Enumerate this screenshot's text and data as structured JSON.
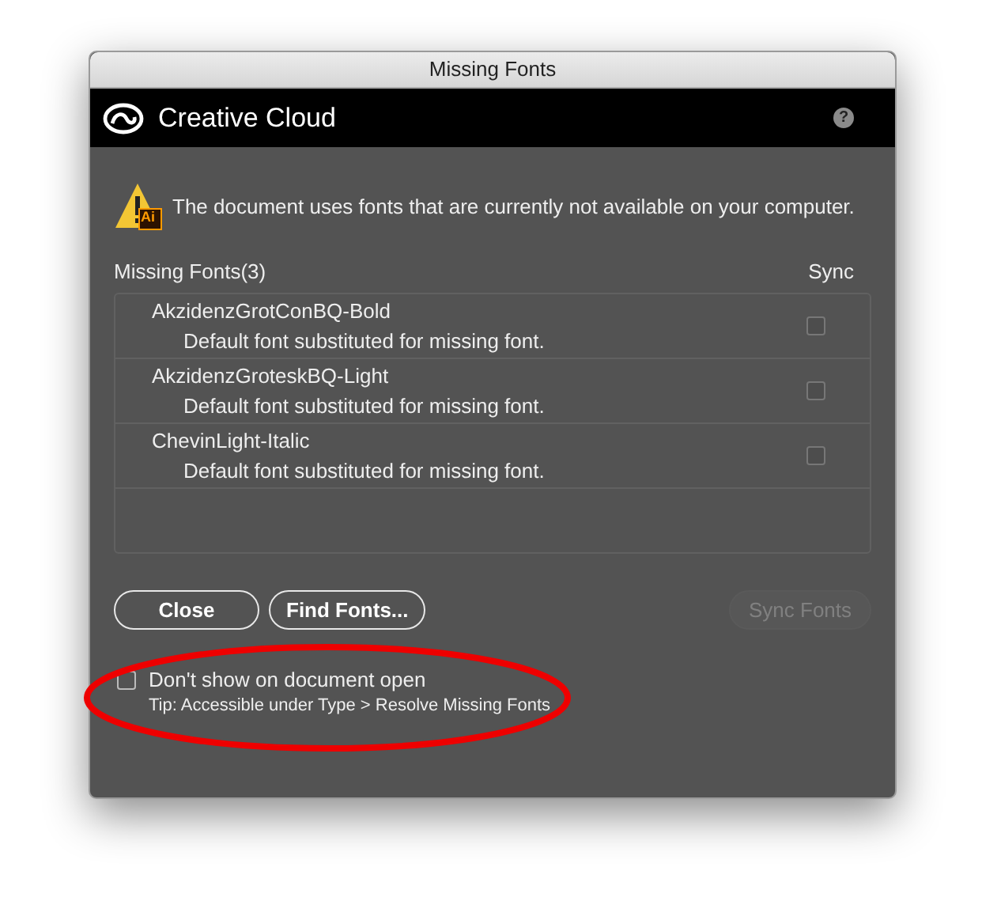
{
  "window": {
    "title": "Missing Fonts"
  },
  "header": {
    "brand": "Creative Cloud",
    "help": "?"
  },
  "message": "The document uses fonts that are currently not available on your computer.",
  "list": {
    "heading": "Missing Fonts(3)",
    "sync_heading": "Sync",
    "rows": [
      {
        "font": "AkzidenzGrotConBQ-Bold",
        "note": "Default font substituted for missing font.",
        "checked": false
      },
      {
        "font": "AkzidenzGroteskBQ-Light",
        "note": "Default font substituted for missing font.",
        "checked": false
      },
      {
        "font": "ChevinLight-Italic",
        "note": "Default font substituted for missing font.",
        "checked": false
      }
    ]
  },
  "buttons": [
    {
      "label": "Close",
      "disabled": false
    },
    {
      "label": "Find Fonts...",
      "disabled": false
    },
    {
      "label": "Sync Fonts",
      "disabled": true
    }
  ],
  "dont_show": {
    "label": "Don't show on document open",
    "checked": false,
    "tip": "Tip: Accessible under Type > Resolve Missing Fonts"
  },
  "annotation": {
    "color": "#ee0000"
  },
  "app_badge": "Ai"
}
